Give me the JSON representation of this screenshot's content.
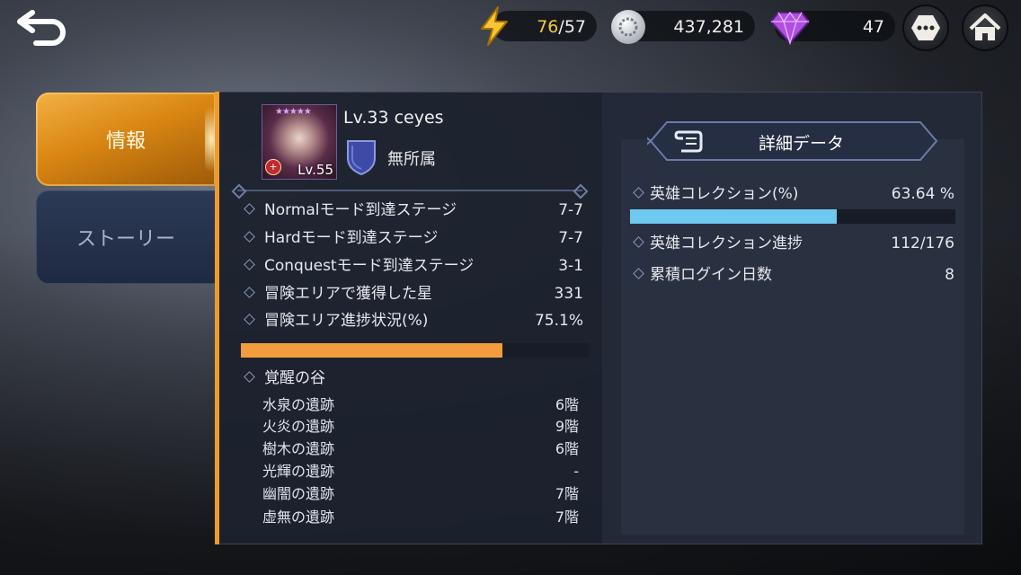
{
  "topbar": {
    "energy": {
      "current": "76",
      "sep": "/",
      "max": "57",
      "current_color": "#f5c842"
    },
    "coins": "437,281",
    "gems": "47"
  },
  "tabs": [
    {
      "label": "情報",
      "active": true
    },
    {
      "label": "ストーリー",
      "active": false
    }
  ],
  "hero": {
    "name": "Lv.33 ceyes",
    "portrait_level": "Lv.55",
    "element": "無所属"
  },
  "stats": [
    {
      "label": "Normalモード到達ステージ",
      "value": "7-7"
    },
    {
      "label": "Hardモード到達ステージ",
      "value": "7-7"
    },
    {
      "label": "Conquestモード到達ステージ",
      "value": "3-1"
    },
    {
      "label": "冒険エリアで獲得した星",
      "value": "331"
    },
    {
      "label": "冒険エリア進捗状況(%)",
      "value": "75.1%"
    }
  ],
  "adventure_progress": {
    "fraction": 0.751,
    "color": "#f39c3e"
  },
  "awakening": {
    "title": "覚醒の谷",
    "ruins": [
      {
        "name": "水泉の遺跡",
        "floor": "6階"
      },
      {
        "name": "火炎の遺跡",
        "floor": "9階"
      },
      {
        "name": "樹木の遺跡",
        "floor": "6階"
      },
      {
        "name": "光輝の遺跡",
        "floor": "-"
      },
      {
        "name": "幽闇の遺跡",
        "floor": "7階"
      },
      {
        "name": "虚無の遺跡",
        "floor": "7階"
      }
    ]
  },
  "detail": {
    "title": "詳細データ",
    "rows": [
      {
        "label": "英雄コレクション(%)",
        "value": "63.64 %"
      },
      {
        "label": "英雄コレクション進捗",
        "value": "112/176"
      },
      {
        "label": "累積ログイン日数",
        "value": "8"
      }
    ],
    "collection_progress": {
      "fraction": 0.6364,
      "color": "#6ec8ef"
    }
  },
  "colors": {
    "accent_orange": "#f09a2a",
    "panel": "#1c212e"
  }
}
